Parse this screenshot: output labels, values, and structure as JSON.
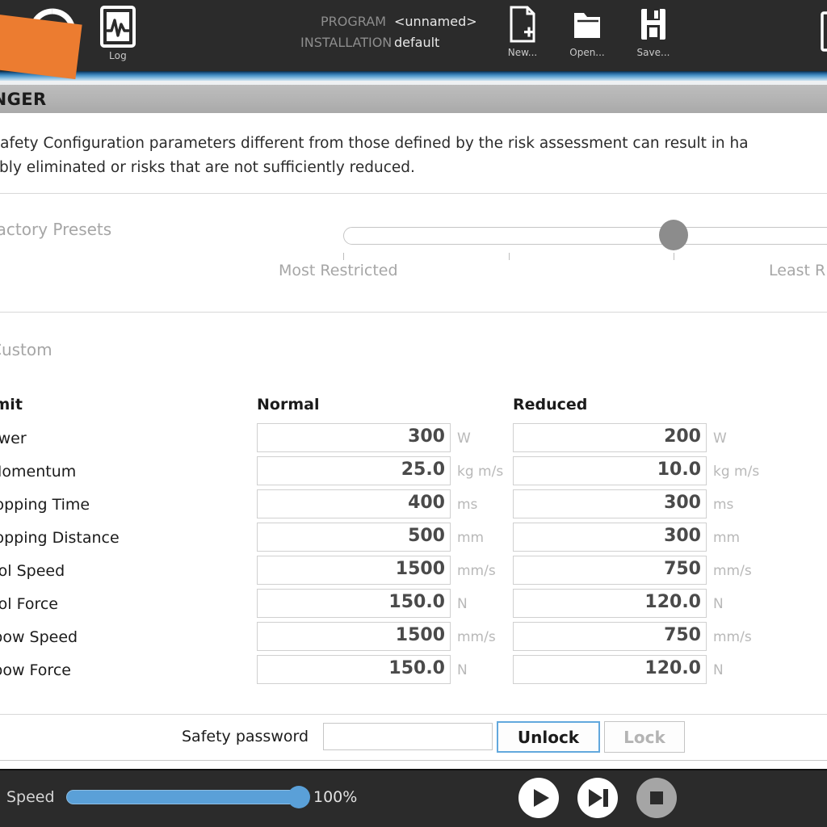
{
  "header": {
    "logo_icon": "ur-logo-icon",
    "log_button": {
      "label": "Log",
      "icon": "waveform-icon"
    },
    "program_key": "PROGRAM",
    "program_value": "<unnamed>",
    "installation_key": "INSTALLATION",
    "installation_value": "default",
    "tools": [
      {
        "label": "New...",
        "icon": "new-file-icon"
      },
      {
        "label": "Open...",
        "icon": "open-folder-icon"
      },
      {
        "label": "Save...",
        "icon": "save-disk-icon"
      }
    ]
  },
  "danger_band": {
    "title": "ANGER"
  },
  "warning": {
    "text": "f Safety Configuration parameters different from those defined by the risk assessment can result in ha\nnably eliminated or risks that are not sufficiently reduced."
  },
  "presets": {
    "label": "Factory Presets",
    "most_restricted": "Most Restricted",
    "least_restricted": "Least R",
    "slider_value": 3,
    "slider_min": 0,
    "slider_max": 4
  },
  "custom": {
    "label": "Custom"
  },
  "table": {
    "columns": [
      "imit",
      "Normal",
      "Reduced"
    ],
    "rows": [
      {
        "limit": "ower",
        "normal": "300",
        "reduced": "200",
        "unit": "W"
      },
      {
        "limit": "Momentum",
        "normal": "25.0",
        "reduced": "10.0",
        "unit": "kg m/s"
      },
      {
        "limit": "topping Time",
        "normal": "400",
        "reduced": "300",
        "unit": "ms"
      },
      {
        "limit": "topping Distance",
        "normal": "500",
        "reduced": "300",
        "unit": "mm"
      },
      {
        "limit": "ool Speed",
        "normal": "1500",
        "reduced": "750",
        "unit": "mm/s"
      },
      {
        "limit": "ool Force",
        "normal": "150.0",
        "reduced": "120.0",
        "unit": "N"
      },
      {
        "limit": "lbow Speed",
        "normal": "1500",
        "reduced": "750",
        "unit": "mm/s"
      },
      {
        "limit": "lbow Force",
        "normal": "150.0",
        "reduced": "120.0",
        "unit": "N"
      }
    ]
  },
  "password_bar": {
    "label": "Safety password",
    "input_value": "",
    "input_placeholder": "",
    "unlock_label": "Unlock",
    "lock_label": "Lock"
  },
  "footer": {
    "speed_label": "Speed",
    "speed_percent": "100%",
    "speed_value": 100,
    "controls": [
      {
        "name": "play-button",
        "icon": "play-icon"
      },
      {
        "name": "step-button",
        "icon": "step-forward-icon"
      },
      {
        "name": "stop-button",
        "icon": "stop-icon"
      }
    ]
  },
  "colors": {
    "header_bg": "#2b2b2b",
    "accent_blue": "#4a93c8",
    "danger_band": "#b3b3b3",
    "orange_overlay": "#ec7c30",
    "speed_blue": "#5aa0d8",
    "focus_blue": "#62a8dd"
  }
}
